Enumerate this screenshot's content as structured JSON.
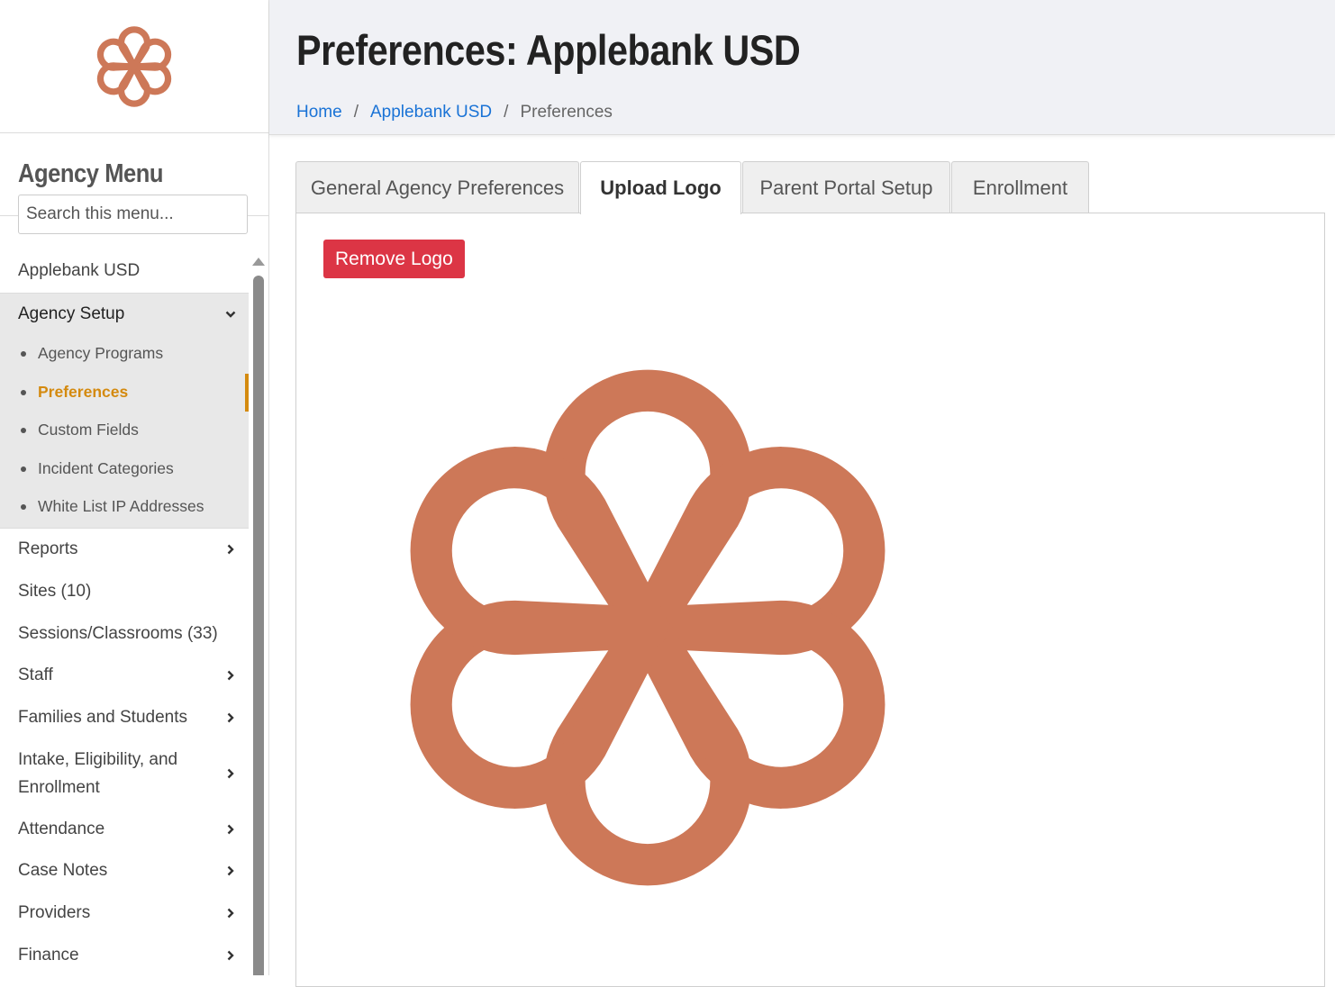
{
  "sidebar": {
    "logo_icon": "flower-logo-icon",
    "menu_title": "Agency Menu",
    "search_placeholder": "Search this menu...",
    "items": [
      {
        "label": "Applebank USD",
        "chevron": ""
      },
      {
        "label": "Agency Setup",
        "chevron": "down",
        "expanded": true,
        "children": [
          {
            "label": "Agency Programs",
            "active": false
          },
          {
            "label": "Preferences",
            "active": true
          },
          {
            "label": "Custom Fields",
            "active": false
          },
          {
            "label": "Incident Categories",
            "active": false
          },
          {
            "label": "White List IP Addresses",
            "active": false
          }
        ]
      },
      {
        "label": "Reports",
        "chevron": "right"
      },
      {
        "label": "Sites (10)",
        "chevron": ""
      },
      {
        "label": "Sessions/Classrooms (33)",
        "chevron": ""
      },
      {
        "label": "Staff",
        "chevron": "right"
      },
      {
        "label": "Families and Students",
        "chevron": "right"
      },
      {
        "label": "Intake, Eligibility, and Enrollment",
        "chevron": "right"
      },
      {
        "label": "Attendance",
        "chevron": "right"
      },
      {
        "label": "Case Notes",
        "chevron": "right"
      },
      {
        "label": "Providers",
        "chevron": "right"
      },
      {
        "label": "Finance",
        "chevron": "right"
      }
    ]
  },
  "header": {
    "title": "Preferences: Applebank USD",
    "breadcrumb": {
      "home": "Home",
      "agency": "Applebank USD",
      "current": "Preferences",
      "separator": "/"
    }
  },
  "tabs": [
    {
      "label": "General Agency Preferences",
      "active": false
    },
    {
      "label": "Upload Logo",
      "active": true
    },
    {
      "label": "Parent Portal Setup",
      "active": false
    },
    {
      "label": "Enrollment",
      "active": false
    }
  ],
  "panel": {
    "remove_button": "Remove Logo",
    "logo_icon": "flower-logo-icon"
  },
  "colors": {
    "logo": "#cd7858",
    "accent_active": "#d48a0f",
    "link": "#1a73d6",
    "danger": "#dc3545"
  }
}
